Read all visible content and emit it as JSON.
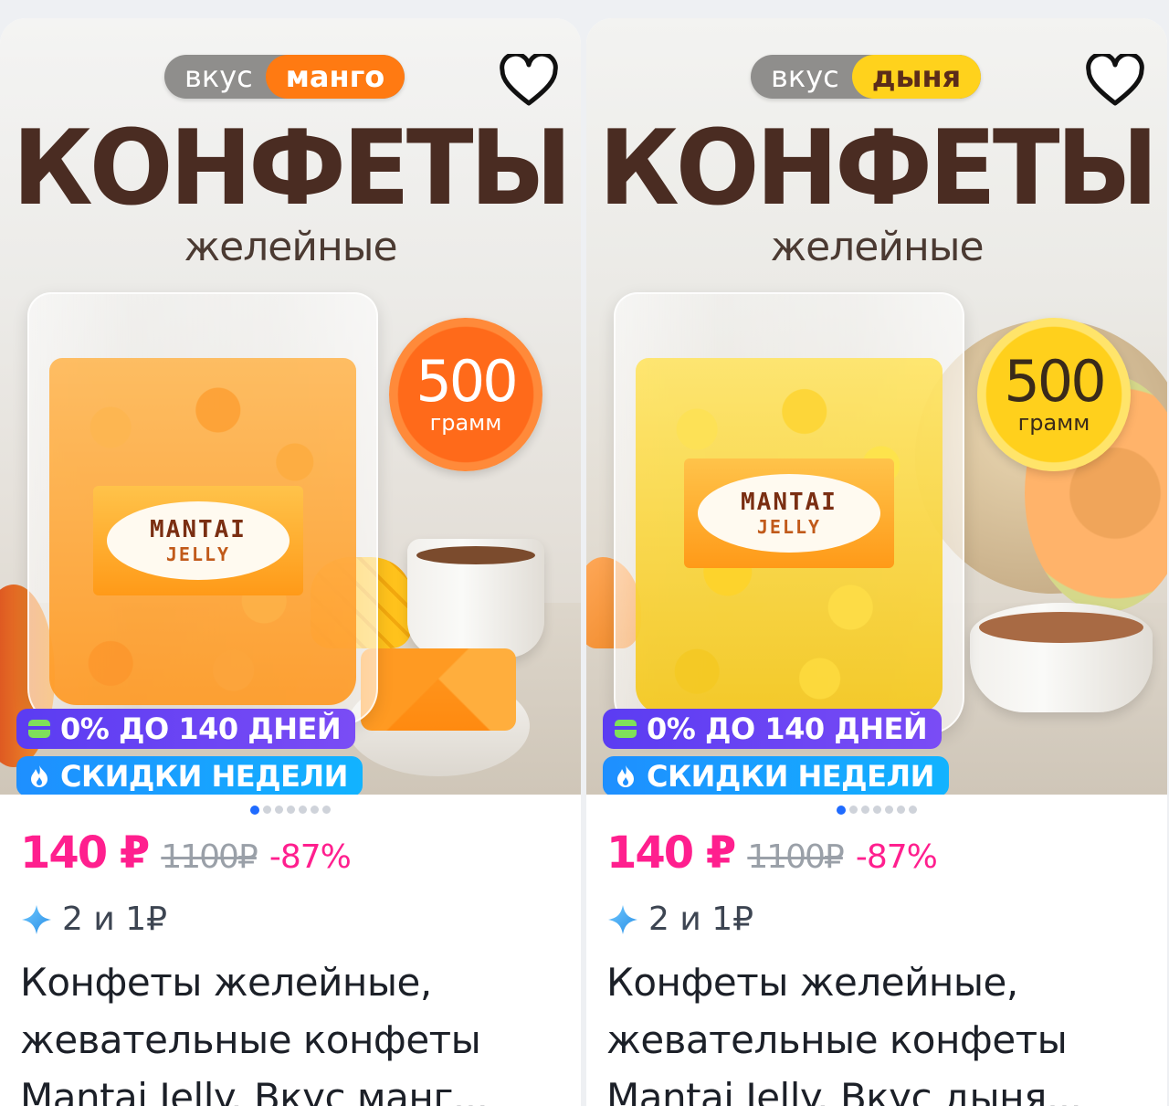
{
  "products": [
    {
      "flavor_prefix": "вкус",
      "flavor": "манго",
      "headline": "КОНФЕТЫ",
      "subheadline": "желейные",
      "brand_line1": "MANTAI",
      "brand_line2": "JELLY",
      "weight_value": "500",
      "weight_unit": "грамм",
      "promo_installment": "0% ДО 140 ДНЕЙ",
      "promo_weekly": "СКИДКИ НЕДЕЛИ",
      "gallery_total": 7,
      "gallery_active": 1,
      "price_now": "140 ₽",
      "price_old": "1100₽",
      "discount": "-87%",
      "bonus": "2 и 1₽",
      "title_lines": [
        "Конфеты желейные,",
        "жевательные конфеты",
        "Mantai Jelly. Вкус манг..."
      ]
    },
    {
      "flavor_prefix": "вкус",
      "flavor": "дыня",
      "headline": "КОНФЕТЫ",
      "subheadline": "желейные",
      "brand_line1": "MANTAI",
      "brand_line2": "JELLY",
      "weight_value": "500",
      "weight_unit": "грамм",
      "promo_installment": "0% ДО 140 ДНЕЙ",
      "promo_weekly": "СКИДКИ НЕДЕЛИ",
      "gallery_total": 7,
      "gallery_active": 1,
      "price_now": "140 ₽",
      "price_old": "1100₽",
      "discount": "-87%",
      "bonus": "2 и 1₽",
      "title_lines": [
        "Конфеты желейные,",
        "жевательные конфеты",
        "Mantai Jelly. Вкус дыня..."
      ]
    }
  ],
  "colors": {
    "price_accent": "#ff1f8e",
    "installment_badge": "#5b3cf2",
    "weekly_badge": "#1e8fff",
    "mango_accent": "#ff7a12",
    "melon_accent": "#ffd21c"
  },
  "icons": {
    "favorite": "heart-outline-icon",
    "installment": "card-stripe-icon",
    "weekly": "fire-icon",
    "bonus": "sparkle-icon"
  }
}
